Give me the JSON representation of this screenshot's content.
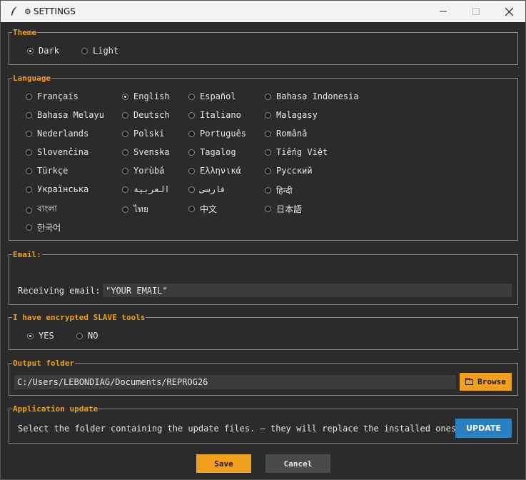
{
  "window": {
    "title": "SETTINGS"
  },
  "theme": {
    "legend": "Theme",
    "options": [
      {
        "label": "Dark",
        "selected": true
      },
      {
        "label": "Light",
        "selected": false
      }
    ]
  },
  "language": {
    "legend": "Language",
    "options": [
      {
        "label": "Français",
        "selected": false
      },
      {
        "label": "English",
        "selected": true
      },
      {
        "label": "Español",
        "selected": false
      },
      {
        "label": "Bahasa Indonesia",
        "selected": false
      },
      {
        "label": "Bahasa Melayu",
        "selected": false
      },
      {
        "label": "Deutsch",
        "selected": false
      },
      {
        "label": "Italiano",
        "selected": false
      },
      {
        "label": "Malagasy",
        "selected": false
      },
      {
        "label": "Nederlands",
        "selected": false
      },
      {
        "label": "Polski",
        "selected": false
      },
      {
        "label": "Português",
        "selected": false
      },
      {
        "label": "Română",
        "selected": false
      },
      {
        "label": "Slovenčina",
        "selected": false
      },
      {
        "label": "Svenska",
        "selected": false
      },
      {
        "label": "Tagalog",
        "selected": false
      },
      {
        "label": "Tiếng Việt",
        "selected": false
      },
      {
        "label": "Türkçe",
        "selected": false
      },
      {
        "label": "Yorùbá",
        "selected": false
      },
      {
        "label": "Ελληνικά",
        "selected": false
      },
      {
        "label": "Русский",
        "selected": false
      },
      {
        "label": "Українська",
        "selected": false
      },
      {
        "label": "العربية",
        "selected": false
      },
      {
        "label": "فارسی",
        "selected": false
      },
      {
        "label": "हिन्दी",
        "selected": false
      },
      {
        "label": "বাংলা",
        "selected": false
      },
      {
        "label": "ไทย",
        "selected": false
      },
      {
        "label": "中文",
        "selected": false
      },
      {
        "label": "日本語",
        "selected": false
      },
      {
        "label": "한국어",
        "selected": false
      }
    ]
  },
  "email": {
    "legend": "Email:",
    "label": "Receiving email:",
    "value": "\"YOUR EMAIL\""
  },
  "slave_tools": {
    "legend": "I have encrypted SLAVE tools",
    "options": [
      {
        "label": "YES",
        "selected": true
      },
      {
        "label": "NO",
        "selected": false
      }
    ]
  },
  "output_folder": {
    "legend": "Output folder",
    "path": "C:/Users/LEBONDIAG/Documents/REPROG26",
    "browse_label": "Browse"
  },
  "update": {
    "legend": "Application update",
    "description": "Select the folder containing the update files. — they will replace the installed ones.",
    "button_label": "UPDATE"
  },
  "footer": {
    "save_label": "Save",
    "cancel_label": "Cancel"
  },
  "colors": {
    "accent": "#f0a01e",
    "update_button": "#2a7fc0",
    "background": "#2b2b2b"
  },
  "icons": [
    "feather-icon",
    "gear-icon",
    "minimize-icon",
    "maximize-icon",
    "close-icon",
    "folder-icon"
  ]
}
